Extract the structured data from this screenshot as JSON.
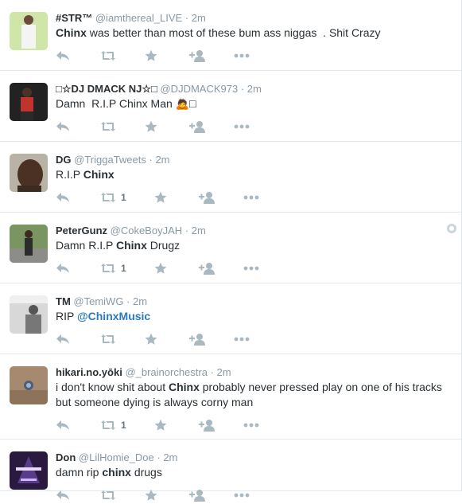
{
  "colors": {
    "text": "#292f33",
    "meta": "#8899a6",
    "link": "#2b7bb9",
    "action": "#aab8c2",
    "border": "#e1e8ed"
  },
  "actions": [
    "reply-icon",
    "retweet-icon",
    "favorite-icon",
    "follow-icon",
    "more-icon"
  ],
  "tweets": [
    {
      "fullname": "#STR™",
      "handle": "@iamthereal_LIVE",
      "time": "2m",
      "body": [
        {
          "b": true,
          "t": "Chinx"
        },
        {
          "t": " was better than most of these bum ass niggas  . Shit Crazy"
        }
      ],
      "retweets": ""
    },
    {
      "fullname": "□☆DJ DMACK NJ☆□",
      "handle": "@DJDMACK973",
      "time": "2m",
      "body": [
        {
          "t": "Damn  R.I.P Chinx Man 🙇□"
        }
      ],
      "retweets": ""
    },
    {
      "fullname": "DG",
      "handle": "@TriggaTweets",
      "time": "2m",
      "body": [
        {
          "t": "R.I.P "
        },
        {
          "b": true,
          "t": "Chinx"
        }
      ],
      "retweets": "1"
    },
    {
      "fullname": "PeterGunz",
      "handle": "@CokeBoyJAH",
      "time": "2m",
      "body": [
        {
          "t": "Damn R.I.P "
        },
        {
          "b": true,
          "t": "Chinx"
        },
        {
          "t": " Drugz"
        }
      ],
      "retweets": "1",
      "gear": true
    },
    {
      "fullname": "TM",
      "handle": "@TemiWG",
      "time": "2m",
      "body": [
        {
          "t": "RIP "
        },
        {
          "m": true,
          "t": "@ChinxMusic"
        }
      ],
      "retweets": ""
    },
    {
      "fullname": "hikari.no.yōki",
      "handle": "@_brainorchestra",
      "time": "2m",
      "body": [
        {
          "t": "i don't know shit about "
        },
        {
          "b": true,
          "t": "Chinx"
        },
        {
          "t": " probably never pressed play on one of his tracks\nbut someone dying is always corny man"
        }
      ],
      "retweets": "1"
    },
    {
      "fullname": "Don",
      "handle": "@LilHomie_Doe",
      "time": "2m",
      "body": [
        {
          "t": "damn rip "
        },
        {
          "b": true,
          "t": "chinx"
        },
        {
          "t": " drugs"
        }
      ],
      "retweets": ""
    }
  ]
}
